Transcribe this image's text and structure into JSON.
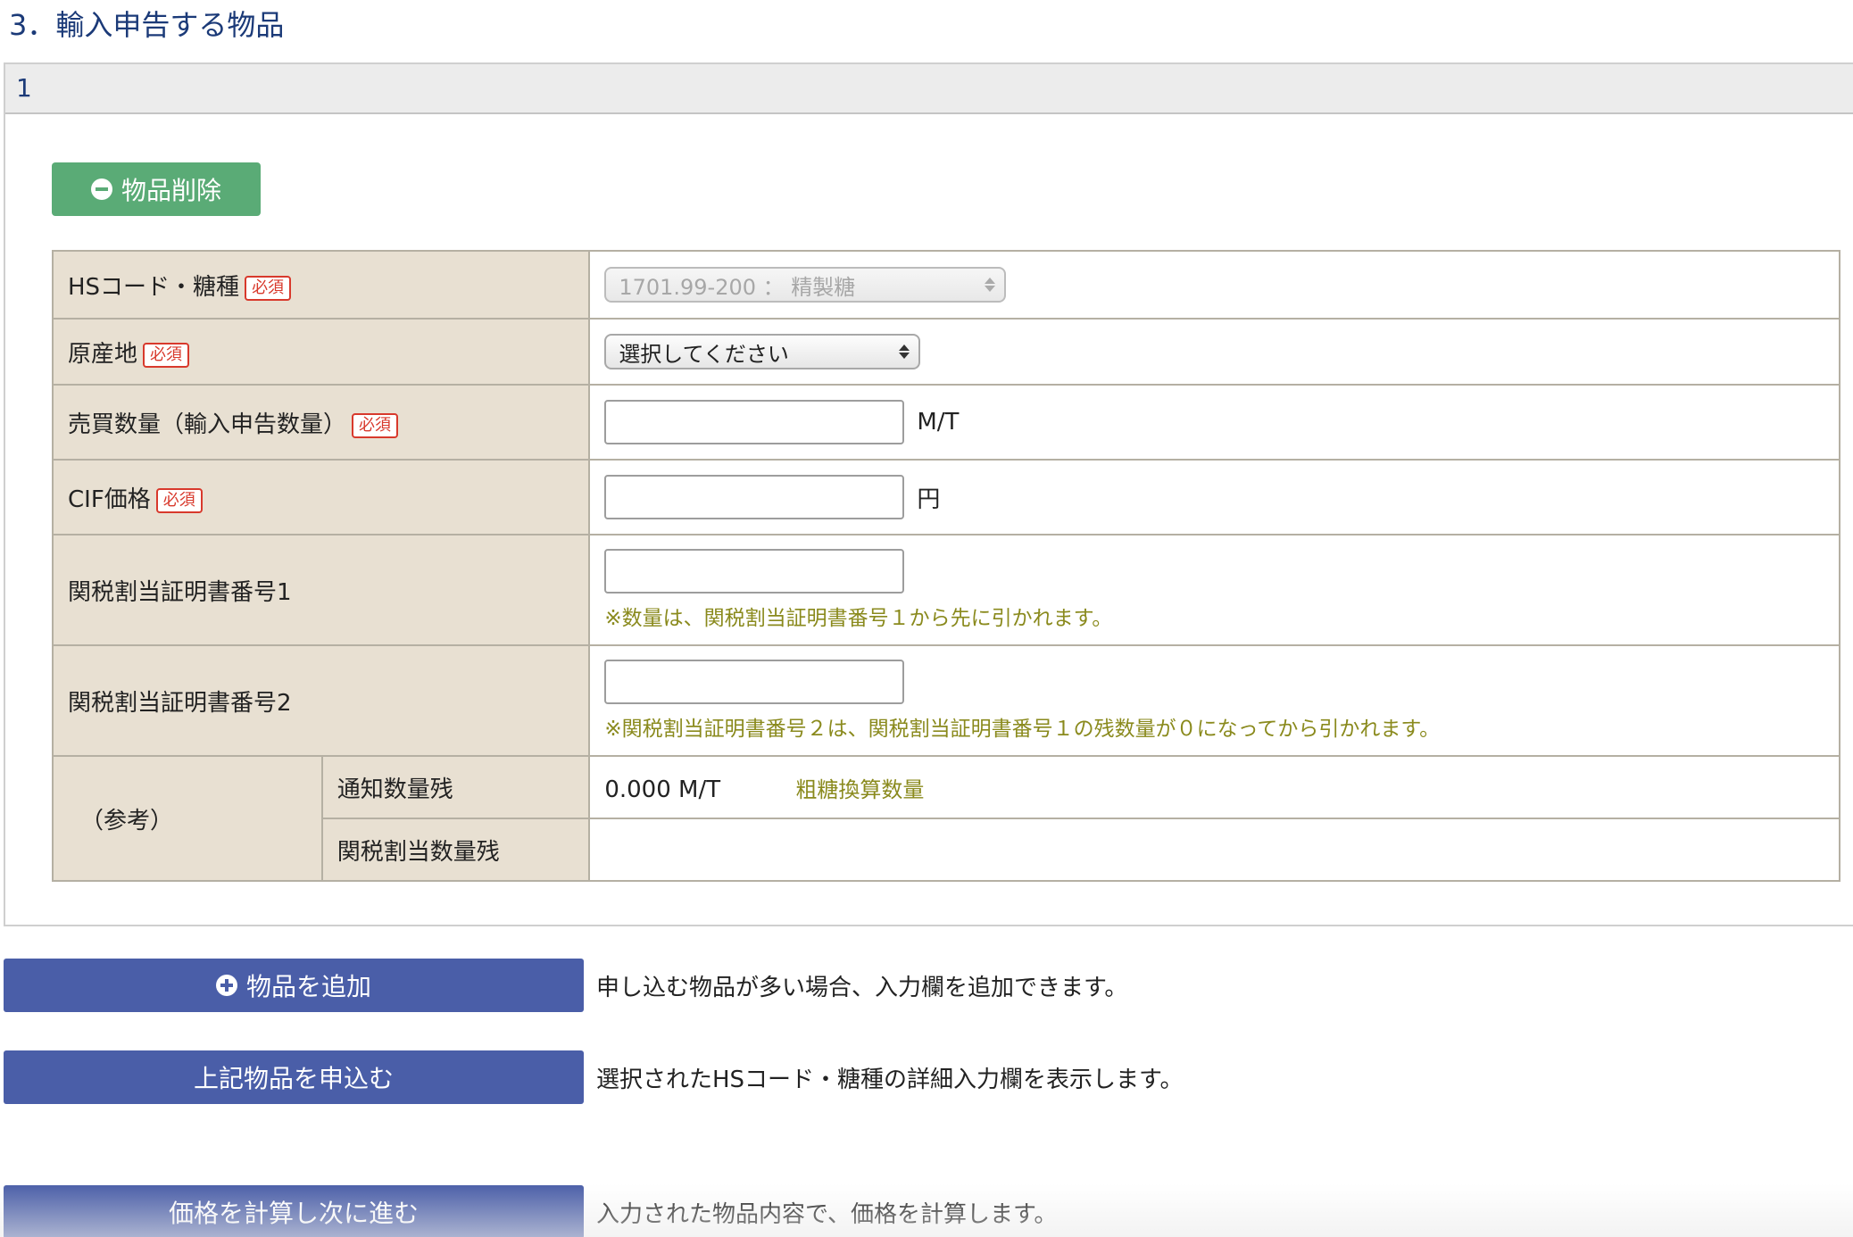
{
  "section": {
    "title": "3．輸入申告する物品"
  },
  "item": {
    "index": "1",
    "delete_button_label": "物品削除",
    "required_badge": "必須",
    "rows": {
      "hs_code": {
        "label": "HSコード・糖種",
        "value": "1701.99-200 ： 精製糖"
      },
      "origin": {
        "label": "原産地",
        "value": "選択してください"
      },
      "quantity": {
        "label": "売買数量（輸入申告数量）",
        "value": "",
        "unit": "M/T"
      },
      "cif": {
        "label": "CIF価格",
        "value": "",
        "unit": "円"
      },
      "cert1": {
        "label": "関税割当証明書番号1",
        "value": "",
        "note": "※数量は、関税割当証明書番号１から先に引かれます。"
      },
      "cert2": {
        "label": "関税割当証明書番号2",
        "value": "",
        "note": "※関税割当証明書番号２は、関税割当証明書番号１の残数量が０になってから引かれます。"
      },
      "reference": {
        "label": "（参考）",
        "notified_label": "通知数量残",
        "notified_value": "0.000 M/T",
        "notified_note": "粗糖換算数量",
        "quota_label": "関税割当数量残",
        "quota_value": ""
      }
    }
  },
  "actions": {
    "add": {
      "label": "物品を追加",
      "desc": "申し込む物品が多い場合、入力欄を追加できます。"
    },
    "apply": {
      "label": "上記物品を申込む",
      "desc": "選択されたHSコード・糖種の詳細入力欄を表示します。"
    },
    "calc": {
      "label": "価格を計算し次に進む",
      "desc": "入力された物品内容で、価格を計算します。"
    }
  },
  "colors": {
    "title_blue": "#1b3a78",
    "delete_green": "#5aab76",
    "action_blue": "#4a5ea8",
    "label_bg": "#e8e0d2",
    "required_red": "#d8392c",
    "note_olive": "#8a8a1d"
  }
}
